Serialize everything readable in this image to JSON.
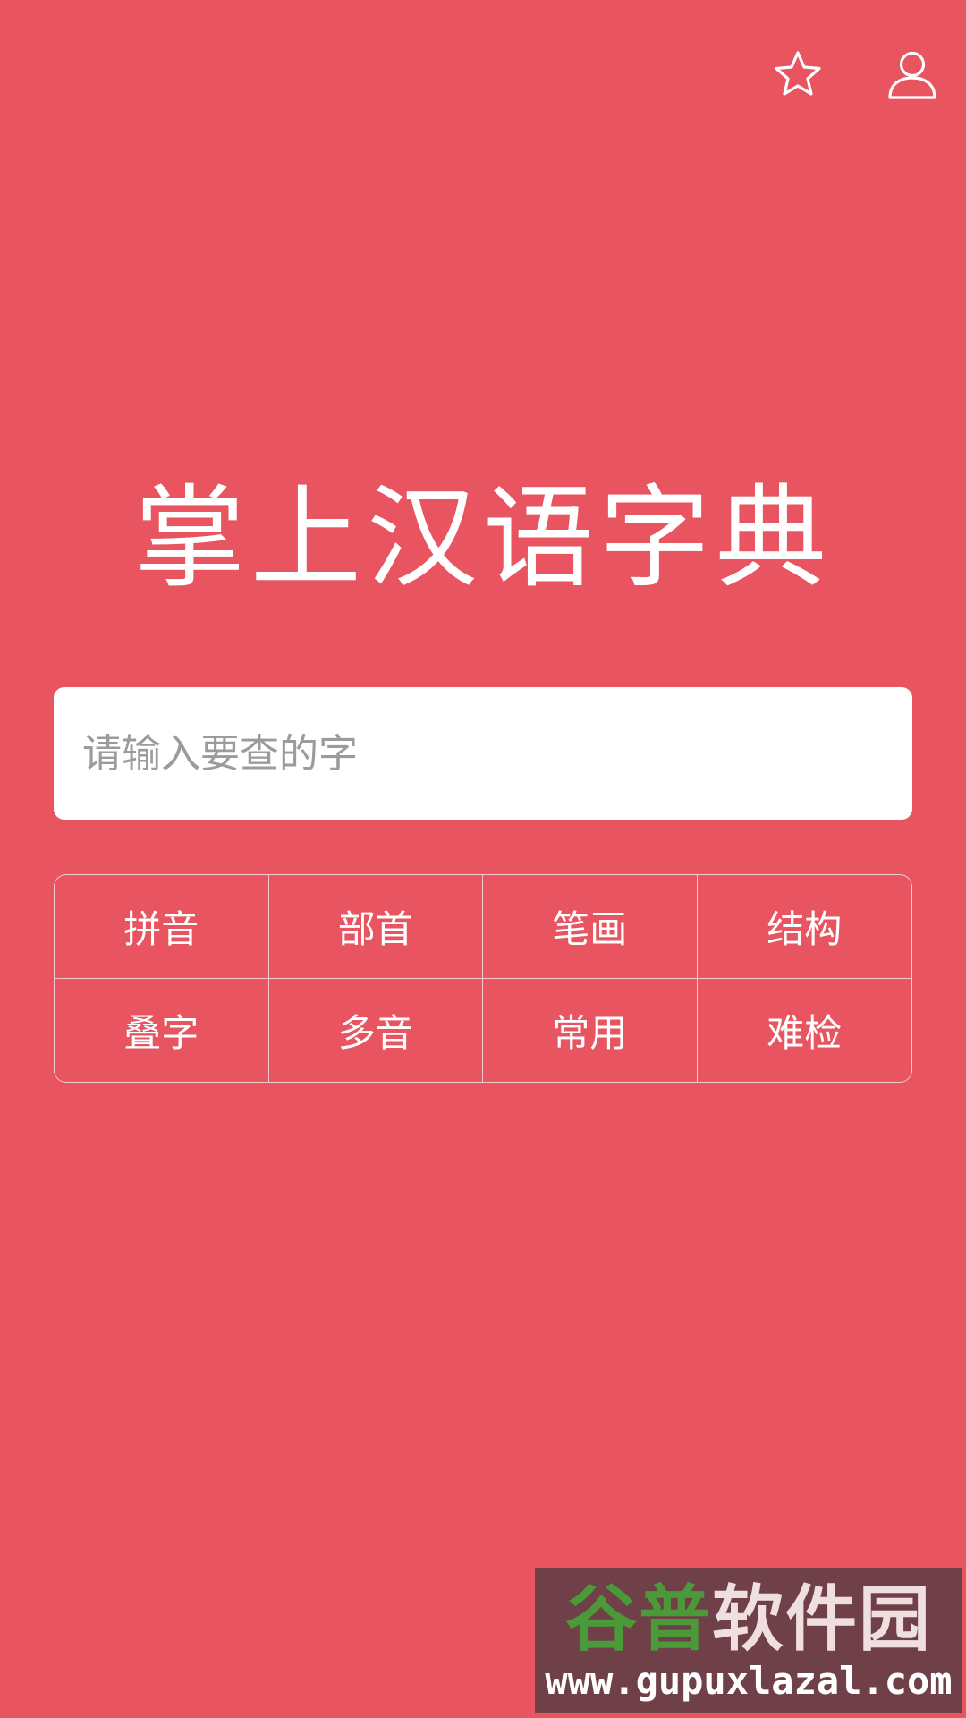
{
  "header": {
    "favorites_icon": "star-icon",
    "profile_icon": "user-icon"
  },
  "app_title": "掌上汉语字典",
  "search": {
    "placeholder": "请输入要查的字",
    "value": ""
  },
  "lookup_grid": {
    "items": [
      {
        "label": "拼音"
      },
      {
        "label": "部首"
      },
      {
        "label": "笔画"
      },
      {
        "label": "结构"
      },
      {
        "label": "叠字"
      },
      {
        "label": "多音"
      },
      {
        "label": "常用"
      },
      {
        "label": "难检"
      }
    ]
  },
  "watermark": {
    "logo_part1": "谷普",
    "logo_part2": "软件园",
    "url": "www.gupuxlazal.com"
  },
  "colors": {
    "background": "#e8545f",
    "search_background": "#ffffff",
    "placeholder": "#9b9b9b",
    "grid_border": "#f5c9cd"
  }
}
